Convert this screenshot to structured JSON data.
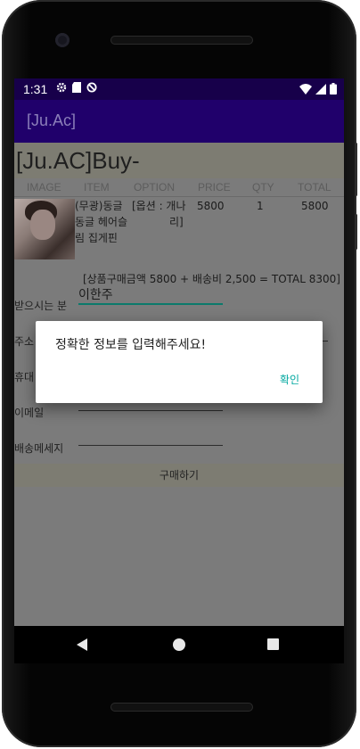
{
  "status_bar": {
    "time": "1:31",
    "left_icons": [
      "gear-icon",
      "sd-card-icon",
      "blocked-icon"
    ],
    "right_icons": [
      "wifi-icon",
      "signal-icon",
      "battery-icon"
    ]
  },
  "app_bar": {
    "title": "[Ju.Ac]"
  },
  "page": {
    "heading": "[Ju.AC]Buy-",
    "columns": [
      "IMAGE",
      "ITEM",
      "OPTION",
      "PRICE",
      "QTY",
      "TOTAL"
    ],
    "product": {
      "item_name_lines": [
        "(무광)동글",
        "동글 헤어슬",
        "림 집게핀"
      ],
      "option_lines": [
        "[옵션 : 개나",
        "리]"
      ],
      "price": "5800",
      "qty": "1",
      "total": "5800"
    },
    "summary": "[상품구매금액 5800 + 배송비 2,500 = TOTAL 8300]",
    "form": {
      "recipient_label": "받으시는 분",
      "recipient_value": "이한주",
      "address_label": "주소",
      "phone_label": "휴대",
      "email_label": "이메일",
      "message_label": "배송메세지"
    },
    "buy_button": "구매하기"
  },
  "dialog": {
    "message": "정확한 정보를 입력해주세요!",
    "confirm": "확인"
  },
  "colors": {
    "status_bar": "#17004a",
    "app_bar": "#20006b",
    "accent": "#00a8a0"
  }
}
